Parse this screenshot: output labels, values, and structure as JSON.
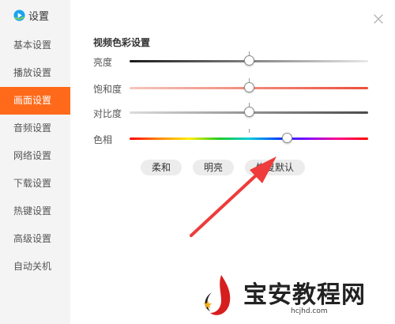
{
  "app": {
    "title": "设置"
  },
  "sidebar": {
    "items": [
      {
        "label": "基本设置",
        "active": false
      },
      {
        "label": "播放设置",
        "active": false
      },
      {
        "label": "画面设置",
        "active": true
      },
      {
        "label": "音频设置",
        "active": false
      },
      {
        "label": "网络设置",
        "active": false
      },
      {
        "label": "下载设置",
        "active": false
      },
      {
        "label": "热键设置",
        "active": false
      },
      {
        "label": "高级设置",
        "active": false
      },
      {
        "label": "自动关机",
        "active": false
      }
    ]
  },
  "panel": {
    "section_title": "视频色彩设置",
    "sliders": [
      {
        "label": "亮度",
        "value": 0.5
      },
      {
        "label": "饱和度",
        "value": 0.5
      },
      {
        "label": "对比度",
        "value": 0.5
      },
      {
        "label": "色相",
        "value": 0.66
      }
    ],
    "buttons": {
      "soft": "柔和",
      "bright": "明亮",
      "reset": "恢复默认"
    }
  },
  "colors": {
    "accent": "#ff6a1a",
    "arrow": "#ef3b3b",
    "brightness_track": [
      "#1a1a1a",
      "#e8e8e8"
    ],
    "saturation_track": [
      "#f4c7bd",
      "#ee4f3c"
    ],
    "contrast_track": [
      "#dcdcdc",
      "#4a4a4a"
    ]
  },
  "watermark": {
    "text": "宝安教程网",
    "url": "hcjhd.com"
  }
}
